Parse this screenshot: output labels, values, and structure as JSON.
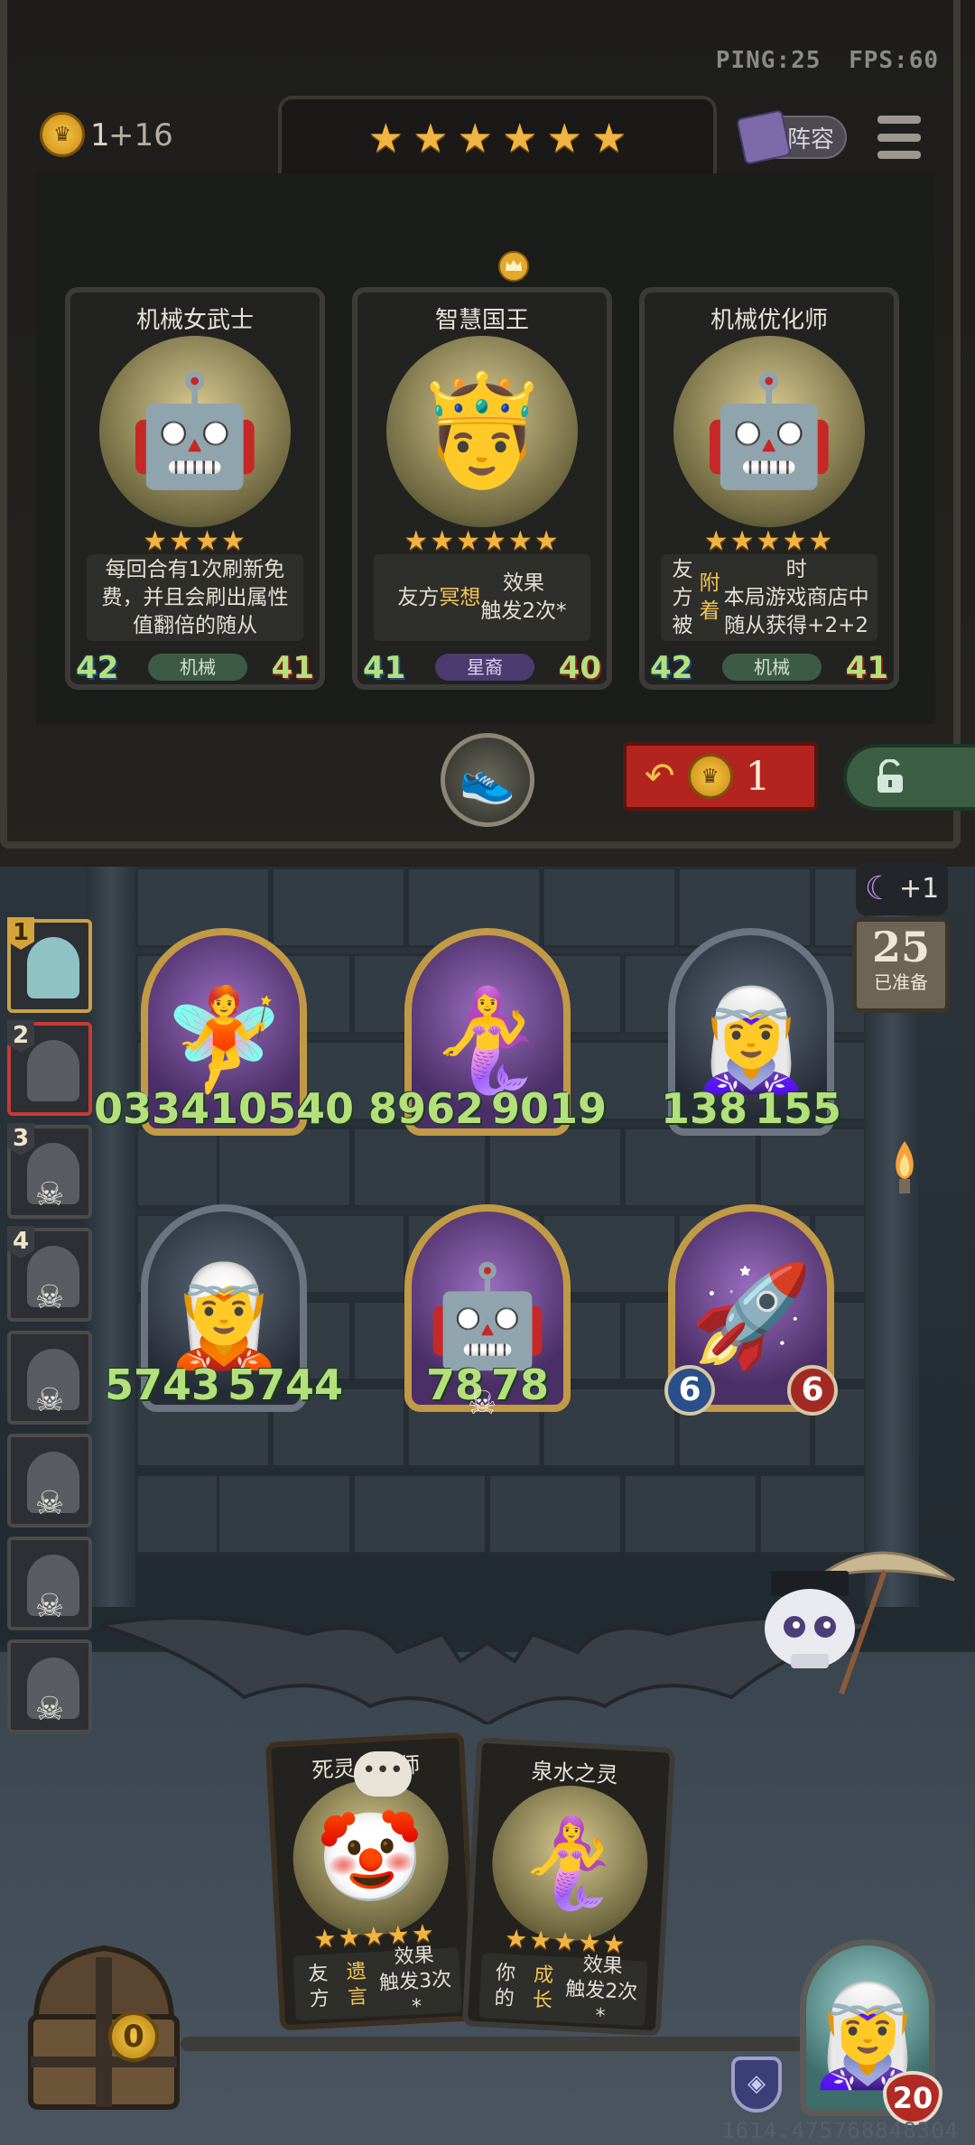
{
  "network": {
    "ping": "PING:25",
    "fps": "FPS:60"
  },
  "gold": {
    "count": "1",
    "income": "+16"
  },
  "tier_stars": [
    "★",
    "★",
    "★",
    "★",
    "★",
    "★"
  ],
  "lineup_button": "阵容",
  "shop_cards": [
    {
      "name": "机械女武士",
      "stars": "★★★★",
      "desc_html": "每回合有1次刷新免费，并且会刷出属性值翻倍的随从",
      "attack": "42",
      "health": "41",
      "tribe": "机械",
      "tribe_style": "mech",
      "icon": "knight-icon"
    },
    {
      "name": "智慧国王",
      "stars": "★★★★★★",
      "desc_html": "友方<b>冥想</b>效果<br>触发2次*",
      "attack": "41",
      "health": "40",
      "tribe": "星裔",
      "tribe_style": "star",
      "icon": "king-icon"
    },
    {
      "name": "机械优化师",
      "stars": "★★★★★",
      "desc_html": "友方被<b>附着</b>时<br>本局游戏商店中随从获得+2+2",
      "attack": "42",
      "health": "41",
      "tribe": "机械",
      "tribe_style": "mech",
      "icon": "robot-icon"
    }
  ],
  "refresh": {
    "cost": "1"
  },
  "moon_bonus": "+1",
  "turn": {
    "number": "25",
    "label": "已准备"
  },
  "opponents": [
    {
      "rank": "1",
      "state": "active"
    },
    {
      "rank": "2",
      "state": "target"
    },
    {
      "rank": "3",
      "state": "dead"
    },
    {
      "rank": "4",
      "state": "dead"
    },
    {
      "rank": "",
      "state": "dead"
    },
    {
      "rank": "",
      "state": "dead"
    },
    {
      "rank": "",
      "state": "dead"
    },
    {
      "rank": "",
      "state": "dead"
    }
  ],
  "minions": [
    {
      "attack": "033410540",
      "health": "",
      "frame": "gold",
      "icon": "fairy-icon"
    },
    {
      "attack": "8962",
      "health": "9019",
      "frame": "gold",
      "icon": "mermaid-icon"
    },
    {
      "attack": "138",
      "health": "155",
      "frame": "silver",
      "icon": "elf-sorceress-icon"
    },
    {
      "attack": "5743",
      "health": "5744",
      "frame": "silver",
      "icon": "dryad-icon"
    },
    {
      "attack": "78",
      "health": "78",
      "frame": "gold",
      "icon": "mech-robot-icon"
    },
    {
      "attack": "6",
      "health": "6",
      "frame": "gold",
      "icon": "airship-icon"
    }
  ],
  "hand_cards": [
    {
      "name": "死灵傀儡师",
      "stars": "★★★★★",
      "desc_html": "友方<b>遗言</b>效果<br>触发3次*",
      "icon": "clown-icon"
    },
    {
      "name": "泉水之灵",
      "stars": "★★★★★",
      "desc_html": "你的<b>成长</b>效果<br>触发2次*",
      "icon": "water-spirit-icon"
    }
  ],
  "chest_count": "0",
  "hero": {
    "health": "20"
  },
  "coordinate_readout": "1614.475768848304"
}
